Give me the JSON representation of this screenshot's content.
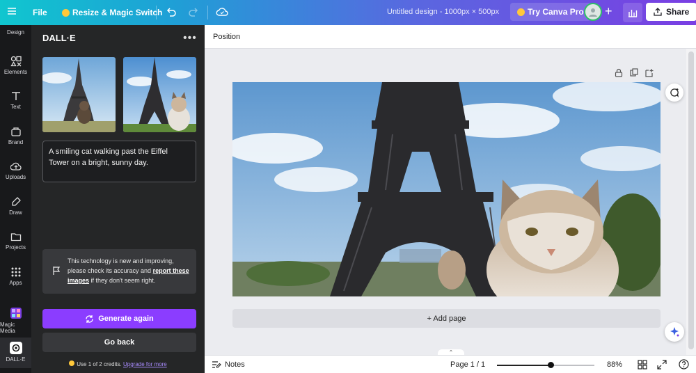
{
  "topbar": {
    "file_label": "File",
    "resize_label": "Resize & Magic Switch",
    "design_title": "Untitled design - 1000px × 500px",
    "pro_label": "Try Canva Pro",
    "share_label": "Share",
    "avatar_icon": "user-avatar"
  },
  "rail": {
    "items": [
      {
        "label": "Design",
        "icon": "design-icon"
      },
      {
        "label": "Elements",
        "icon": "elements-icon"
      },
      {
        "label": "Text",
        "icon": "text-icon"
      },
      {
        "label": "Brand",
        "icon": "brand-icon"
      },
      {
        "label": "Uploads",
        "icon": "uploads-icon"
      },
      {
        "label": "Draw",
        "icon": "draw-icon"
      },
      {
        "label": "Projects",
        "icon": "projects-icon"
      },
      {
        "label": "Apps",
        "icon": "apps-icon"
      },
      {
        "label": "Magic Media",
        "icon": "magic-media-icon"
      },
      {
        "label": "DALL·E",
        "icon": "dalle-icon"
      }
    ]
  },
  "panel": {
    "title": "DALL·E",
    "prompt": "A smiling cat walking past the Eiffel Tower on a bright, sunny day.",
    "notice_pre": "This technology is new and improving, please check its accuracy and ",
    "notice_link": "report these images",
    "notice_post": " if they don't seem right.",
    "generate_label": "Generate again",
    "back_label": "Go back",
    "credits_text": "Use 1 of 2 credits.",
    "credits_link": "Upgrade for more"
  },
  "editor": {
    "position_label": "Position",
    "add_page_label": "+ Add page"
  },
  "footer": {
    "notes_label": "Notes",
    "page_label": "Page 1 / 1",
    "zoom_label": "88%",
    "zoom_fraction": 0.55
  },
  "colors": {
    "accent": "#8b3dff",
    "panel_bg": "#252627",
    "rail_bg": "#18191b"
  }
}
